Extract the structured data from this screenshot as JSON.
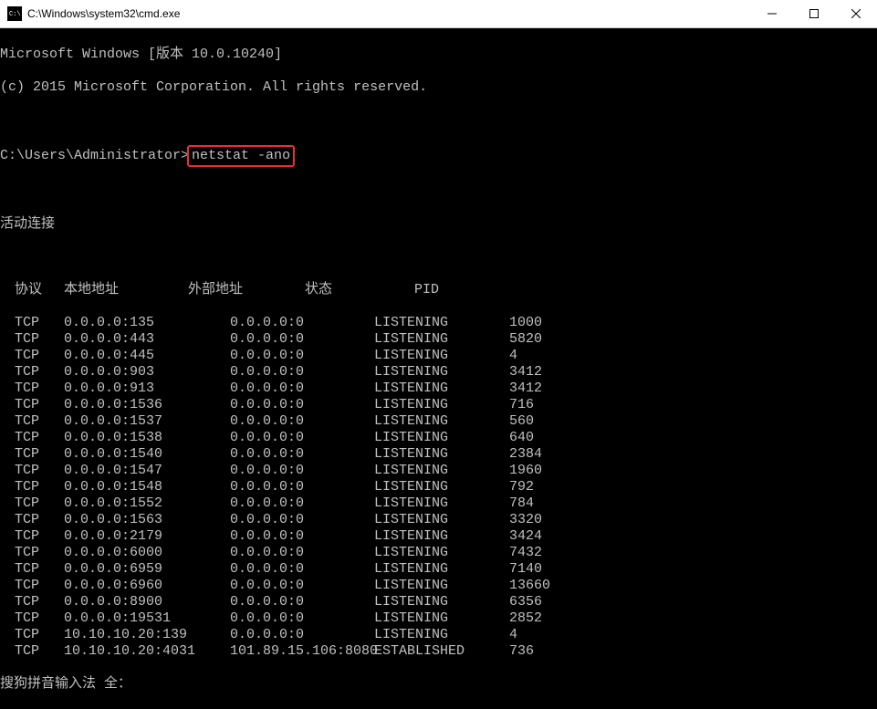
{
  "titlebar": {
    "title": "C:\\Windows\\system32\\cmd.exe"
  },
  "header": {
    "version_line": "Microsoft Windows [版本 10.0.10240]",
    "copyright_line": "(c) 2015 Microsoft Corporation. All rights reserved."
  },
  "prompt": {
    "path": "C:\\Users\\Administrator>",
    "command": "netstat -ano"
  },
  "section_title": "活动连接",
  "columns": {
    "proto": "协议",
    "local": "本地地址",
    "foreign": "外部地址",
    "state": "状态",
    "pid": "PID"
  },
  "rows": [
    {
      "proto": "TCP",
      "local": "0.0.0.0:135",
      "foreign": "0.0.0.0:0",
      "state": "LISTENING",
      "pid": "1000"
    },
    {
      "proto": "TCP",
      "local": "0.0.0.0:443",
      "foreign": "0.0.0.0:0",
      "state": "LISTENING",
      "pid": "5820"
    },
    {
      "proto": "TCP",
      "local": "0.0.0.0:445",
      "foreign": "0.0.0.0:0",
      "state": "LISTENING",
      "pid": "4"
    },
    {
      "proto": "TCP",
      "local": "0.0.0.0:903",
      "foreign": "0.0.0.0:0",
      "state": "LISTENING",
      "pid": "3412"
    },
    {
      "proto": "TCP",
      "local": "0.0.0.0:913",
      "foreign": "0.0.0.0:0",
      "state": "LISTENING",
      "pid": "3412"
    },
    {
      "proto": "TCP",
      "local": "0.0.0.0:1536",
      "foreign": "0.0.0.0:0",
      "state": "LISTENING",
      "pid": "716"
    },
    {
      "proto": "TCP",
      "local": "0.0.0.0:1537",
      "foreign": "0.0.0.0:0",
      "state": "LISTENING",
      "pid": "560"
    },
    {
      "proto": "TCP",
      "local": "0.0.0.0:1538",
      "foreign": "0.0.0.0:0",
      "state": "LISTENING",
      "pid": "640"
    },
    {
      "proto": "TCP",
      "local": "0.0.0.0:1540",
      "foreign": "0.0.0.0:0",
      "state": "LISTENING",
      "pid": "2384"
    },
    {
      "proto": "TCP",
      "local": "0.0.0.0:1547",
      "foreign": "0.0.0.0:0",
      "state": "LISTENING",
      "pid": "1960"
    },
    {
      "proto": "TCP",
      "local": "0.0.0.0:1548",
      "foreign": "0.0.0.0:0",
      "state": "LISTENING",
      "pid": "792"
    },
    {
      "proto": "TCP",
      "local": "0.0.0.0:1552",
      "foreign": "0.0.0.0:0",
      "state": "LISTENING",
      "pid": "784"
    },
    {
      "proto": "TCP",
      "local": "0.0.0.0:1563",
      "foreign": "0.0.0.0:0",
      "state": "LISTENING",
      "pid": "3320"
    },
    {
      "proto": "TCP",
      "local": "0.0.0.0:2179",
      "foreign": "0.0.0.0:0",
      "state": "LISTENING",
      "pid": "3424"
    },
    {
      "proto": "TCP",
      "local": "0.0.0.0:6000",
      "foreign": "0.0.0.0:0",
      "state": "LISTENING",
      "pid": "7432"
    },
    {
      "proto": "TCP",
      "local": "0.0.0.0:6959",
      "foreign": "0.0.0.0:0",
      "state": "LISTENING",
      "pid": "7140"
    },
    {
      "proto": "TCP",
      "local": "0.0.0.0:6960",
      "foreign": "0.0.0.0:0",
      "state": "LISTENING",
      "pid": "13660"
    },
    {
      "proto": "TCP",
      "local": "0.0.0.0:8900",
      "foreign": "0.0.0.0:0",
      "state": "LISTENING",
      "pid": "6356"
    },
    {
      "proto": "TCP",
      "local": "0.0.0.0:19531",
      "foreign": "0.0.0.0:0",
      "state": "LISTENING",
      "pid": "2852"
    },
    {
      "proto": "TCP",
      "local": "10.10.10.20:139",
      "foreign": "0.0.0.0:0",
      "state": "LISTENING",
      "pid": "4"
    },
    {
      "proto": "TCP",
      "local": "10.10.10.20:4031",
      "foreign": "101.89.15.106:8080",
      "state": "ESTABLISHED",
      "pid": "736"
    }
  ],
  "ime_hint": "搜狗拼音输入法 全："
}
